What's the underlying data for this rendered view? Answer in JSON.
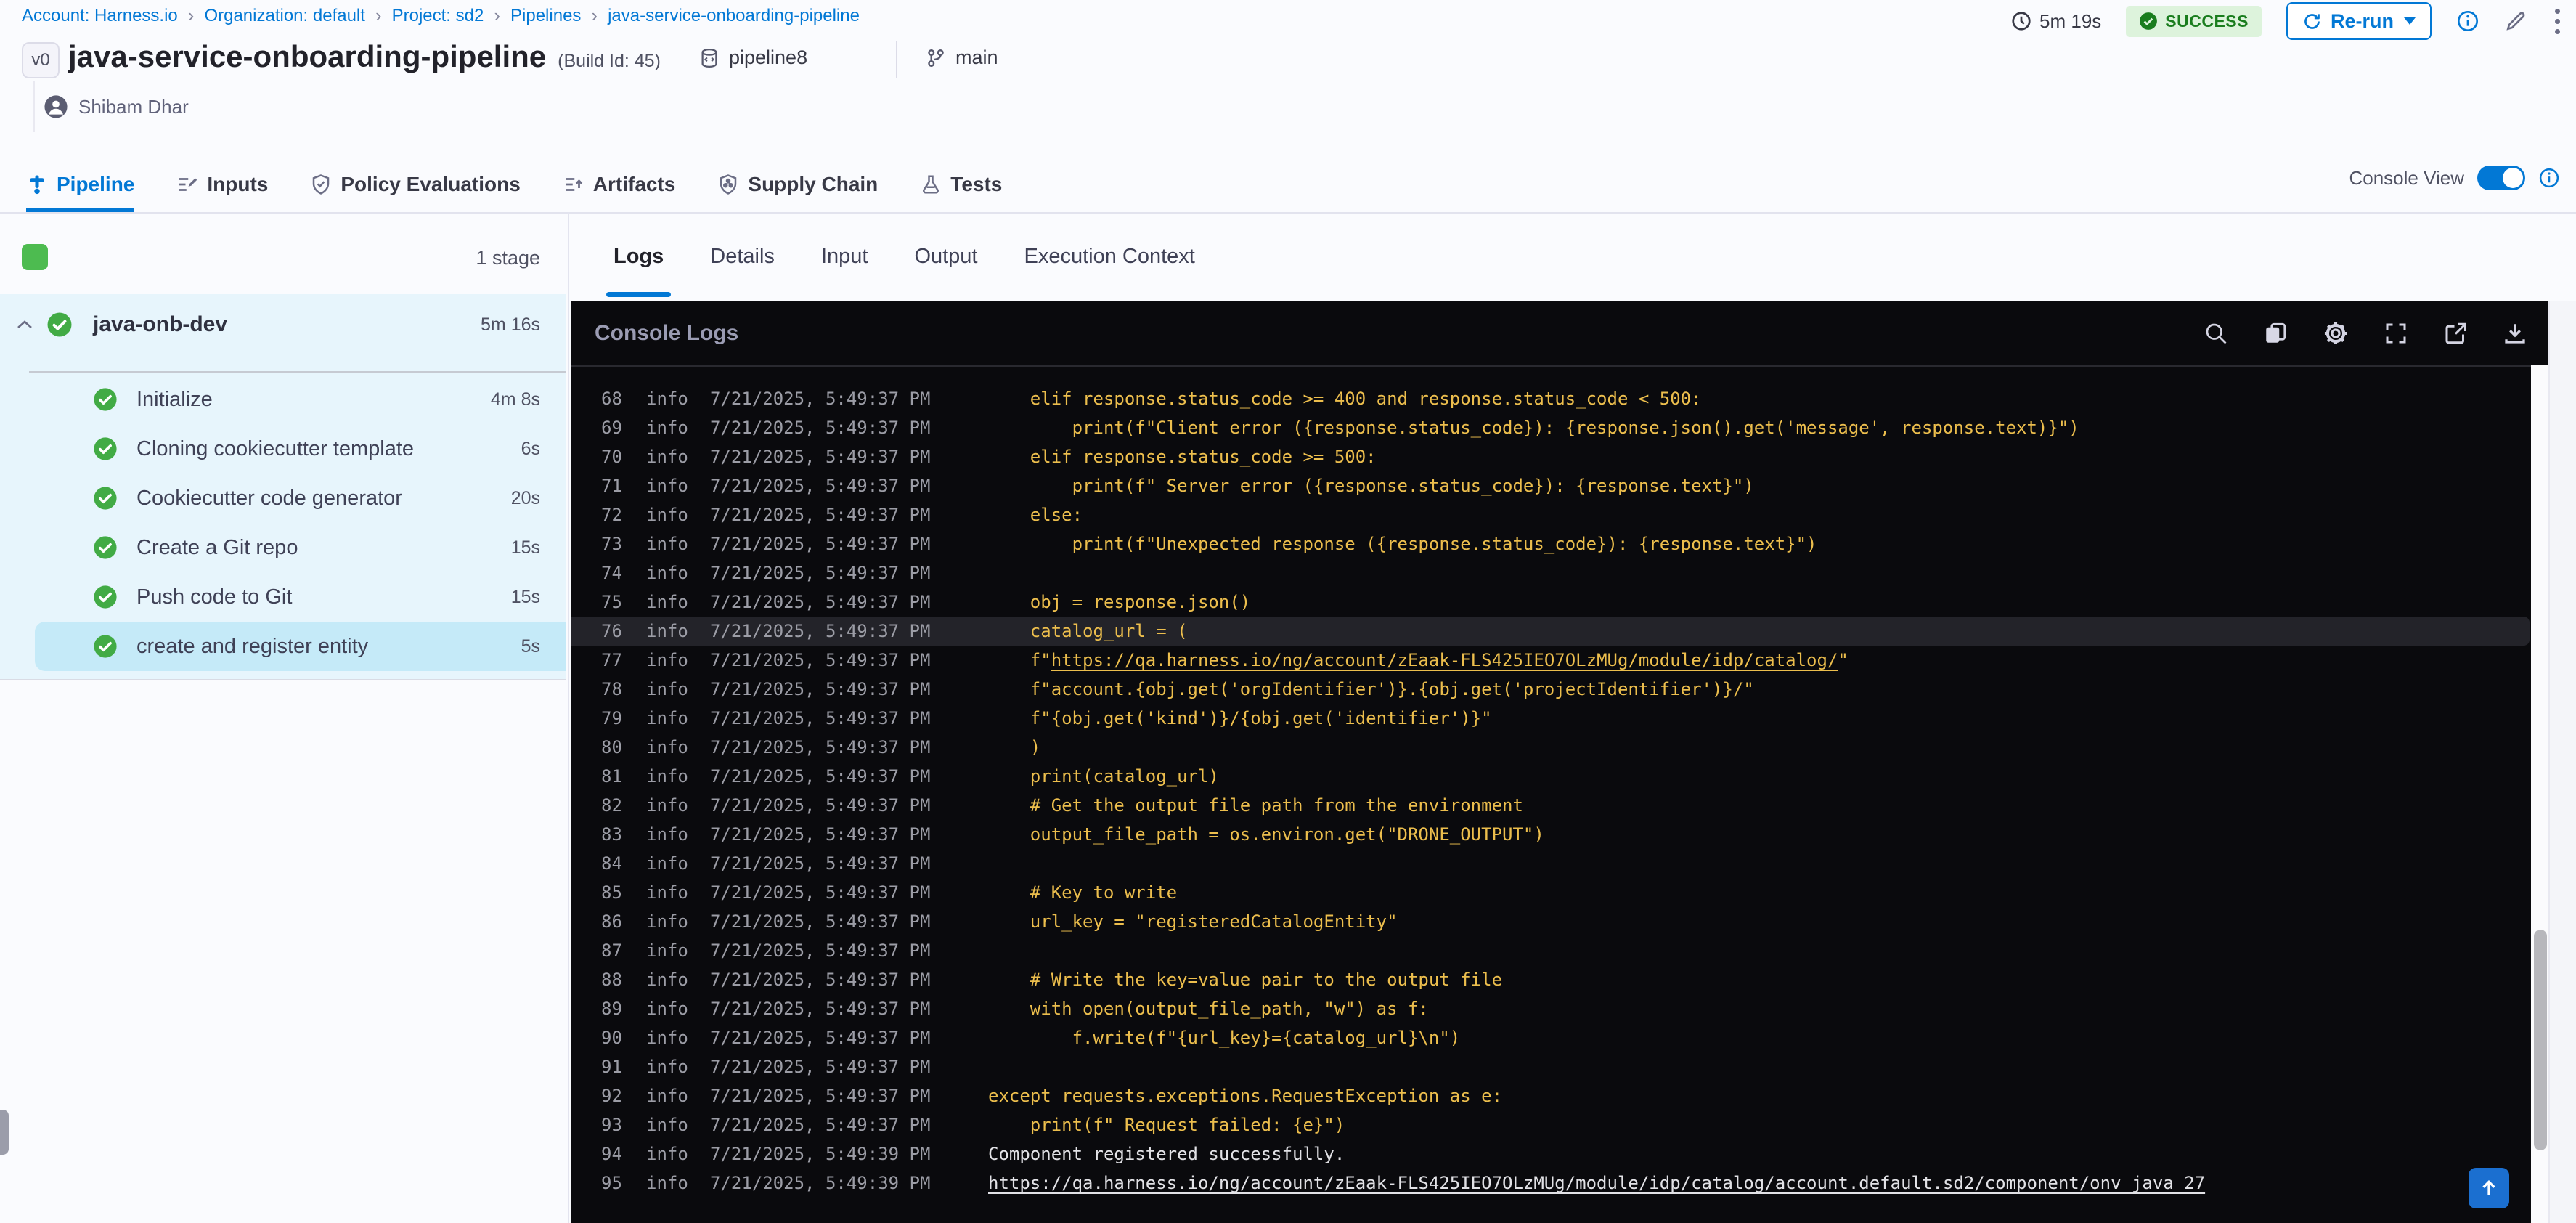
{
  "colors": {
    "accent": "#0278d5",
    "success_green": "#42ab45",
    "badge_bg": "#ddf3dc",
    "badge_text": "#1a7d1e",
    "console_bg": "#0a0a0d",
    "code_yellow": "#ecbe4d",
    "sidebar_bg": "#e7f5fc",
    "sidebar_selected": "#c5eaf8"
  },
  "breadcrumb": {
    "items": [
      "Account: Harness.io",
      "Organization: default",
      "Project: sd2",
      "Pipelines",
      "java-service-onboarding-pipeline"
    ],
    "separator": "›"
  },
  "topbar": {
    "duration": "5m 19s",
    "status": "SUCCESS",
    "rerun_label": "Re-run"
  },
  "header": {
    "version_badge": "v0",
    "title": "java-service-onboarding-pipeline",
    "build_id": "(Build Id: 45)",
    "pipeline_tag": "pipeline8",
    "branch": "main",
    "user": "Shibam Dhar"
  },
  "tabs": [
    {
      "label": "Pipeline",
      "active": true
    },
    {
      "label": "Inputs",
      "active": false
    },
    {
      "label": "Policy Evaluations",
      "active": false
    },
    {
      "label": "Artifacts",
      "active": false
    },
    {
      "label": "Supply Chain",
      "active": false
    },
    {
      "label": "Tests",
      "active": false
    }
  ],
  "console_view": {
    "label": "Console View",
    "enabled": true
  },
  "sidebar": {
    "stage_count": "1 stage",
    "stage": {
      "name": "java-onb-dev",
      "duration": "5m 16s"
    },
    "steps": [
      {
        "name": "Initialize",
        "duration": "4m 8s",
        "selected": false
      },
      {
        "name": "Cloning cookiecutter template",
        "duration": "6s",
        "selected": false
      },
      {
        "name": "Cookiecutter code generator",
        "duration": "20s",
        "selected": false
      },
      {
        "name": "Create a Git repo",
        "duration": "15s",
        "selected": false
      },
      {
        "name": "Push code to Git",
        "duration": "15s",
        "selected": false
      },
      {
        "name": "create and register entity",
        "duration": "5s",
        "selected": true
      }
    ]
  },
  "panel_tabs": [
    {
      "label": "Logs",
      "active": true
    },
    {
      "label": "Details",
      "active": false
    },
    {
      "label": "Input",
      "active": false
    },
    {
      "label": "Output",
      "active": false
    },
    {
      "label": "Execution Context",
      "active": false
    }
  ],
  "console": {
    "title": "Console Logs",
    "icons": [
      "search-icon",
      "copy-icon",
      "settings-icon",
      "fullscreen-icon",
      "open-new-tab-icon",
      "download-icon"
    ]
  },
  "logs": {
    "level_label": "info",
    "lines": [
      {
        "n": 68,
        "t": "7/21/2025, 5:49:37 PM",
        "c": "y",
        "hl": false,
        "seg": [
          [
            "    elif response.status_code >= 400 and response.status_code < 500:",
            false
          ]
        ]
      },
      {
        "n": 69,
        "t": "7/21/2025, 5:49:37 PM",
        "c": "y",
        "hl": false,
        "seg": [
          [
            "        print(f\"Client error ({response.status_code}): {response.json().get('message', response.text)}\")",
            false
          ]
        ]
      },
      {
        "n": 70,
        "t": "7/21/2025, 5:49:37 PM",
        "c": "y",
        "hl": false,
        "seg": [
          [
            "    elif response.status_code >= 500:",
            false
          ]
        ]
      },
      {
        "n": 71,
        "t": "7/21/2025, 5:49:37 PM",
        "c": "y",
        "hl": false,
        "seg": [
          [
            "        print(f\" Server error ({response.status_code}): {response.text}\")",
            false
          ]
        ]
      },
      {
        "n": 72,
        "t": "7/21/2025, 5:49:37 PM",
        "c": "y",
        "hl": false,
        "seg": [
          [
            "    else:",
            false
          ]
        ]
      },
      {
        "n": 73,
        "t": "7/21/2025, 5:49:37 PM",
        "c": "y",
        "hl": false,
        "seg": [
          [
            "        print(f\"Unexpected response ({response.status_code}): {response.text}\")",
            false
          ]
        ]
      },
      {
        "n": 74,
        "t": "7/21/2025, 5:49:37 PM",
        "c": "y",
        "hl": false,
        "seg": [
          [
            "",
            false
          ]
        ]
      },
      {
        "n": 75,
        "t": "7/21/2025, 5:49:37 PM",
        "c": "y",
        "hl": false,
        "seg": [
          [
            "    obj = response.json()",
            false
          ]
        ]
      },
      {
        "n": 76,
        "t": "7/21/2025, 5:49:37 PM",
        "c": "y",
        "hl": true,
        "seg": [
          [
            "    catalog_url = (",
            false
          ]
        ]
      },
      {
        "n": 77,
        "t": "7/21/2025, 5:49:37 PM",
        "c": "y",
        "hl": false,
        "seg": [
          [
            "    f\"",
            false
          ],
          [
            "https://qa.harness.io/ng/account/zEaak-FLS425IEO7OLzMUg/module/idp/catalog/",
            true
          ],
          [
            "\"",
            false
          ]
        ]
      },
      {
        "n": 78,
        "t": "7/21/2025, 5:49:37 PM",
        "c": "y",
        "hl": false,
        "seg": [
          [
            "    f\"account.{obj.get('orgIdentifier')}.{obj.get('projectIdentifier')}/\"",
            false
          ]
        ]
      },
      {
        "n": 79,
        "t": "7/21/2025, 5:49:37 PM",
        "c": "y",
        "hl": false,
        "seg": [
          [
            "    f\"{obj.get('kind')}/{obj.get('identifier')}\"",
            false
          ]
        ]
      },
      {
        "n": 80,
        "t": "7/21/2025, 5:49:37 PM",
        "c": "y",
        "hl": false,
        "seg": [
          [
            "    )",
            false
          ]
        ]
      },
      {
        "n": 81,
        "t": "7/21/2025, 5:49:37 PM",
        "c": "y",
        "hl": false,
        "seg": [
          [
            "    print(catalog_url)",
            false
          ]
        ]
      },
      {
        "n": 82,
        "t": "7/21/2025, 5:49:37 PM",
        "c": "y",
        "hl": false,
        "seg": [
          [
            "    # Get the output file path from the environment",
            false
          ]
        ]
      },
      {
        "n": 83,
        "t": "7/21/2025, 5:49:37 PM",
        "c": "y",
        "hl": false,
        "seg": [
          [
            "    output_file_path = os.environ.get(\"DRONE_OUTPUT\")",
            false
          ]
        ]
      },
      {
        "n": 84,
        "t": "7/21/2025, 5:49:37 PM",
        "c": "y",
        "hl": false,
        "seg": [
          [
            "",
            false
          ]
        ]
      },
      {
        "n": 85,
        "t": "7/21/2025, 5:49:37 PM",
        "c": "y",
        "hl": false,
        "seg": [
          [
            "    # Key to write",
            false
          ]
        ]
      },
      {
        "n": 86,
        "t": "7/21/2025, 5:49:37 PM",
        "c": "y",
        "hl": false,
        "seg": [
          [
            "    url_key = \"registeredCatalogEntity\"",
            false
          ]
        ]
      },
      {
        "n": 87,
        "t": "7/21/2025, 5:49:37 PM",
        "c": "y",
        "hl": false,
        "seg": [
          [
            "",
            false
          ]
        ]
      },
      {
        "n": 88,
        "t": "7/21/2025, 5:49:37 PM",
        "c": "y",
        "hl": false,
        "seg": [
          [
            "    # Write the key=value pair to the output file",
            false
          ]
        ]
      },
      {
        "n": 89,
        "t": "7/21/2025, 5:49:37 PM",
        "c": "y",
        "hl": false,
        "seg": [
          [
            "    with open(output_file_path, \"w\") as f:",
            false
          ]
        ]
      },
      {
        "n": 90,
        "t": "7/21/2025, 5:49:37 PM",
        "c": "y",
        "hl": false,
        "seg": [
          [
            "        f.write(f\"{url_key}={catalog_url}\\n\")",
            false
          ]
        ]
      },
      {
        "n": 91,
        "t": "7/21/2025, 5:49:37 PM",
        "c": "y",
        "hl": false,
        "seg": [
          [
            "",
            false
          ]
        ]
      },
      {
        "n": 92,
        "t": "7/21/2025, 5:49:37 PM",
        "c": "y",
        "hl": false,
        "seg": [
          [
            "except requests.exceptions.RequestException as e:",
            false
          ]
        ]
      },
      {
        "n": 93,
        "t": "7/21/2025, 5:49:37 PM",
        "c": "y",
        "hl": false,
        "seg": [
          [
            "    print(f\" Request failed: {e}\")",
            false
          ]
        ]
      },
      {
        "n": 94,
        "t": "7/21/2025, 5:49:39 PM",
        "c": "w",
        "hl": false,
        "seg": [
          [
            "Component registered successfully.",
            false
          ]
        ]
      },
      {
        "n": 95,
        "t": "7/21/2025, 5:49:39 PM",
        "c": "w",
        "hl": false,
        "seg": [
          [
            "https://qa.harness.io/ng/account/zEaak-FLS425IEO7OLzMUg/module/idp/catalog/account.default.sd2/component/onv_java_27",
            true
          ]
        ]
      }
    ]
  }
}
